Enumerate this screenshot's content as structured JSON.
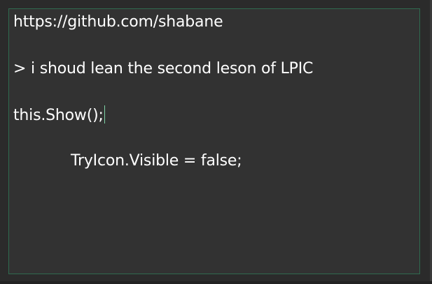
{
  "editor": {
    "lines": [
      "https://github.com/shabane",
      "> i shoud lean the second leson of LPIC",
      "this.Show();",
      "TryIcon.Visible = false;"
    ]
  },
  "colors": {
    "background": "#2b2b2b",
    "editor_background": "#323232",
    "editor_border": "#2f6b4f",
    "text": "#ffffff",
    "caret": "#7fd3a6"
  }
}
